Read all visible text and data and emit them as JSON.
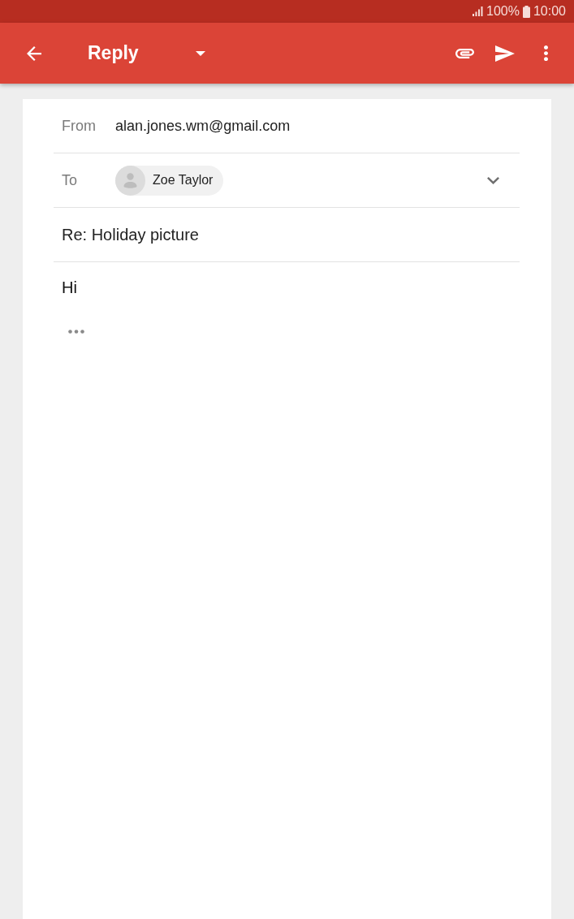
{
  "status_bar": {
    "battery": "100%",
    "time": "10:00"
  },
  "app_bar": {
    "title": "Reply"
  },
  "compose": {
    "from": {
      "label": "From",
      "value": "alan.jones.wm@gmail.com"
    },
    "to": {
      "label": "To",
      "recipients": [
        {
          "name": "Zoe Taylor"
        }
      ],
      "expanded": false
    },
    "subject": "Re: Holiday picture",
    "body": "Hi"
  }
}
